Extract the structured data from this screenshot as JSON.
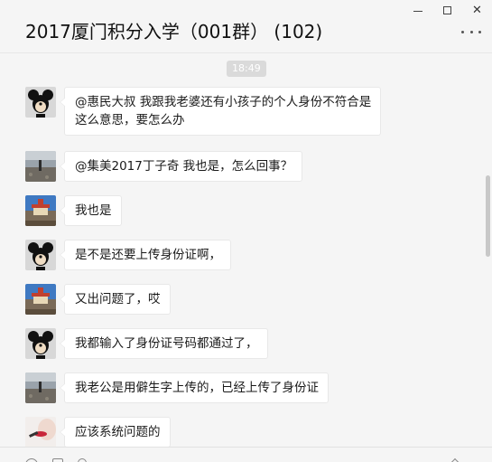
{
  "window": {
    "title": "2017厦门积分入学（001群） (102)",
    "controls": {
      "minimize": "minimize",
      "maximize": "maximize",
      "close": "✕"
    }
  },
  "chat": {
    "time": "18:49",
    "messages": [
      {
        "avatar": "mickey-mouse-avatar",
        "text_lines": [
          "@惠民大叔 我跟我老婆还有小孩子的个人身份不符合是",
          "这么意思，要怎么办"
        ]
      },
      {
        "avatar": "beach-avatar",
        "text_lines": [
          "@集美2017丁子奇 我也是，怎么回事？"
        ]
      },
      {
        "avatar": "temple-avatar",
        "text_lines": [
          "我也是"
        ]
      },
      {
        "avatar": "mickey-mouse-avatar",
        "text_lines": [
          "是不是还要上传身份证啊，"
        ]
      },
      {
        "avatar": "temple-avatar",
        "text_lines": [
          "又出问题了，哎"
        ]
      },
      {
        "avatar": "mickey-mouse-avatar",
        "text_lines": [
          "我都输入了身份证号码都通过了，"
        ]
      },
      {
        "avatar": "beach-avatar",
        "text_lines": [
          "我老公是用僻生字上传的，已经上传了身份证"
        ]
      },
      {
        "avatar": "lips-avatar",
        "text_lines": [
          "应该系统问题的"
        ]
      }
    ]
  },
  "colors": {
    "background": "#f5f5f5",
    "bubble": "#ffffff",
    "bubble_border": "#e8e8e8",
    "time_pill": "#dadada"
  }
}
